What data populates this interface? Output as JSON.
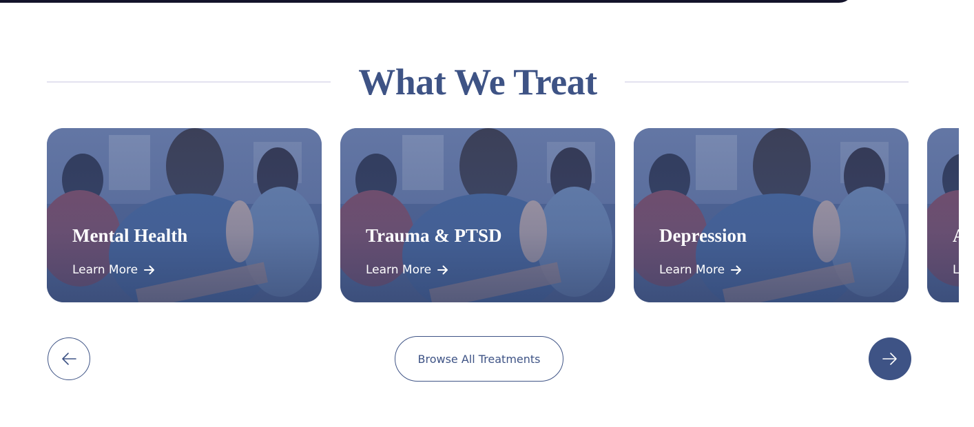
{
  "section": {
    "title": "What We Treat"
  },
  "cards": [
    {
      "title": "Mental Health",
      "link_label": "Learn More"
    },
    {
      "title": "Trauma & PTSD",
      "link_label": "Learn More"
    },
    {
      "title": "Depression",
      "link_label": "Learn More"
    },
    {
      "title": "A",
      "link_label": "L"
    }
  ],
  "controls": {
    "browse_label": "Browse All Treatments",
    "prev_icon": "arrow-left-icon",
    "next_icon": "arrow-right-icon"
  },
  "colors": {
    "brand": "#3e5385",
    "top_bar": "#14142b",
    "rule": "#e3e2ef",
    "card_text": "#ffffff"
  }
}
